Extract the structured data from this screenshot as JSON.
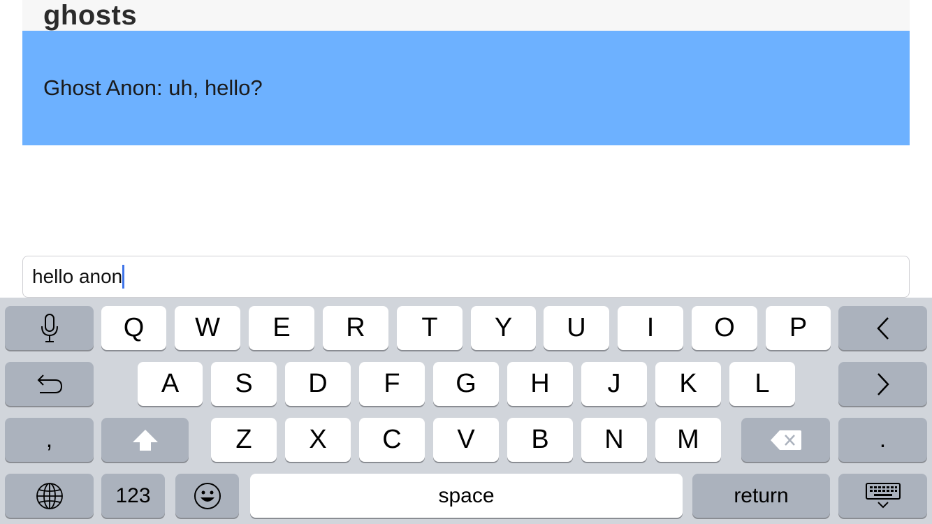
{
  "room": {
    "title": "ghosts"
  },
  "messages": [
    {
      "text": "Ghost Anon: uh, hello?"
    }
  ],
  "input": {
    "value": "hello anon"
  },
  "keyboard": {
    "row1": [
      "Q",
      "W",
      "E",
      "R",
      "T",
      "Y",
      "U",
      "I",
      "O",
      "P"
    ],
    "row2": [
      "A",
      "S",
      "D",
      "F",
      "G",
      "H",
      "J",
      "K",
      "L"
    ],
    "row3": [
      "Z",
      "X",
      "C",
      "V",
      "B",
      "N",
      "M"
    ],
    "comma": ",",
    "period": ".",
    "numbers_label": "123",
    "space_label": "space",
    "return_label": "return",
    "icons": {
      "dictation": "microphone-icon",
      "undo": "undo-arrow-icon",
      "prev": "chevron-left-icon",
      "next": "chevron-right-icon",
      "shift": "shift-arrow-icon",
      "delete": "backspace-icon",
      "globe": "globe-icon",
      "emoji": "smiley-icon",
      "dismiss": "keyboard-dismiss-icon"
    }
  },
  "colors": {
    "message_panel": "#6db1ff",
    "keyboard_bg": "#d1d5db",
    "func_key": "#abb2bd",
    "caret": "#3f74e8"
  }
}
